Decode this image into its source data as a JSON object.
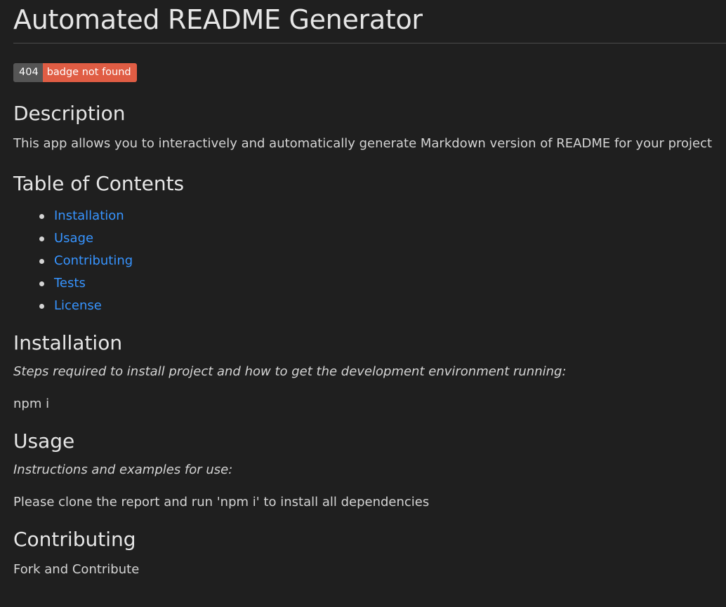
{
  "title": "Automated README Generator",
  "badge": {
    "left": "404",
    "right": "badge not found",
    "left_color": "#555555",
    "right_color": "#e05d44"
  },
  "description": {
    "heading": "Description",
    "text": "This app allows you to interactively and automatically generate Markdown version of README for your project"
  },
  "toc": {
    "heading": "Table of Contents",
    "items": [
      {
        "label": "Installation"
      },
      {
        "label": "Usage"
      },
      {
        "label": "Contributing"
      },
      {
        "label": "Tests"
      },
      {
        "label": "License"
      }
    ]
  },
  "installation": {
    "heading": "Installation",
    "intro": "Steps required to install project and how to get the development environment running:",
    "text": "npm i"
  },
  "usage": {
    "heading": "Usage",
    "intro": "Instructions and examples for use:",
    "text": "Please clone the report and run 'npm i' to install all dependencies"
  },
  "contributing": {
    "heading": "Contributing",
    "text": "Fork and Contribute"
  },
  "colors": {
    "background": "#1f1f1f",
    "text": "#d4d4d4",
    "link": "#3794ff"
  }
}
